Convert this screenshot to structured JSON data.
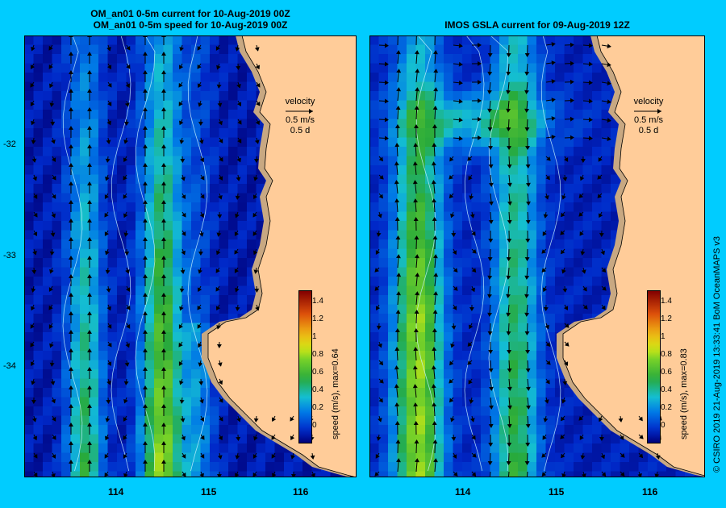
{
  "left_panel": {
    "title_line1": "OM_an01 0-5m current for 10-Aug-2019 00Z",
    "title_line2": "OM_an01 0-5m speed for 10-Aug-2019 00Z",
    "colorbar_label": "speed (m/s), max=0.64",
    "max_speed": 0.64
  },
  "right_panel": {
    "title": "IMOS GSLA current for 09-Aug-2019 12Z",
    "colorbar_label": "speed (m/s), max=0.83",
    "max_speed": 0.83
  },
  "velocity_legend": {
    "label": "velocity",
    "speed": "0.5 m/s",
    "duration": "0.5 d"
  },
  "axes": {
    "x_ticks": [
      "114",
      "115",
      "116"
    ],
    "y_ticks": [
      "-32",
      "-33",
      "-34"
    ]
  },
  "colorbar": {
    "ticks": [
      "1.4",
      "1.2",
      "1",
      "0.8",
      "0.6",
      "0.4",
      "0.2",
      "0"
    ]
  },
  "credit": "© CSIRO 2019   21-Aug-2019 13:33:41 BoM OceanMAPS v3",
  "colors": {
    "background": "#00ccff",
    "land": "#ffcc99",
    "shelf": "#c8a882"
  }
}
